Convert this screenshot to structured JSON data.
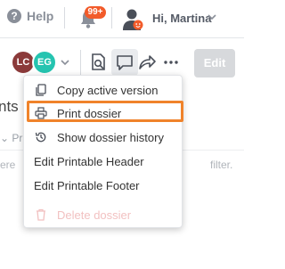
{
  "header": {
    "help_label": "Help",
    "help_glyph": "?",
    "notifications_badge": "99+",
    "user_greeting": "Hi, Martina"
  },
  "toolbar": {
    "avatars": [
      {
        "initials": "LC",
        "color": "#8b3a3a"
      },
      {
        "initials": "EG",
        "color": "#25c4b0"
      }
    ],
    "edit_label": "Edit"
  },
  "background": {
    "title_fragment": "nts &",
    "breadcrumb_fragment": "Pri",
    "text_fragment": "ere",
    "filter_fragment": "filter."
  },
  "menu": {
    "items": [
      {
        "label": "Copy active version",
        "icon": "copy-icon"
      },
      {
        "label": "Print dossier",
        "icon": "printer-icon",
        "highlighted": true
      },
      {
        "label": "Show dossier history",
        "icon": "history-icon"
      },
      {
        "label": "Edit Printable Header"
      },
      {
        "label": "Edit Printable Footer"
      },
      {
        "label": "Delete dossier",
        "icon": "trash-icon",
        "disabled": true
      }
    ]
  },
  "colors": {
    "highlight": "#f0832b",
    "badge": "#f25b2a",
    "disabled_text": "#f2c1c1"
  }
}
